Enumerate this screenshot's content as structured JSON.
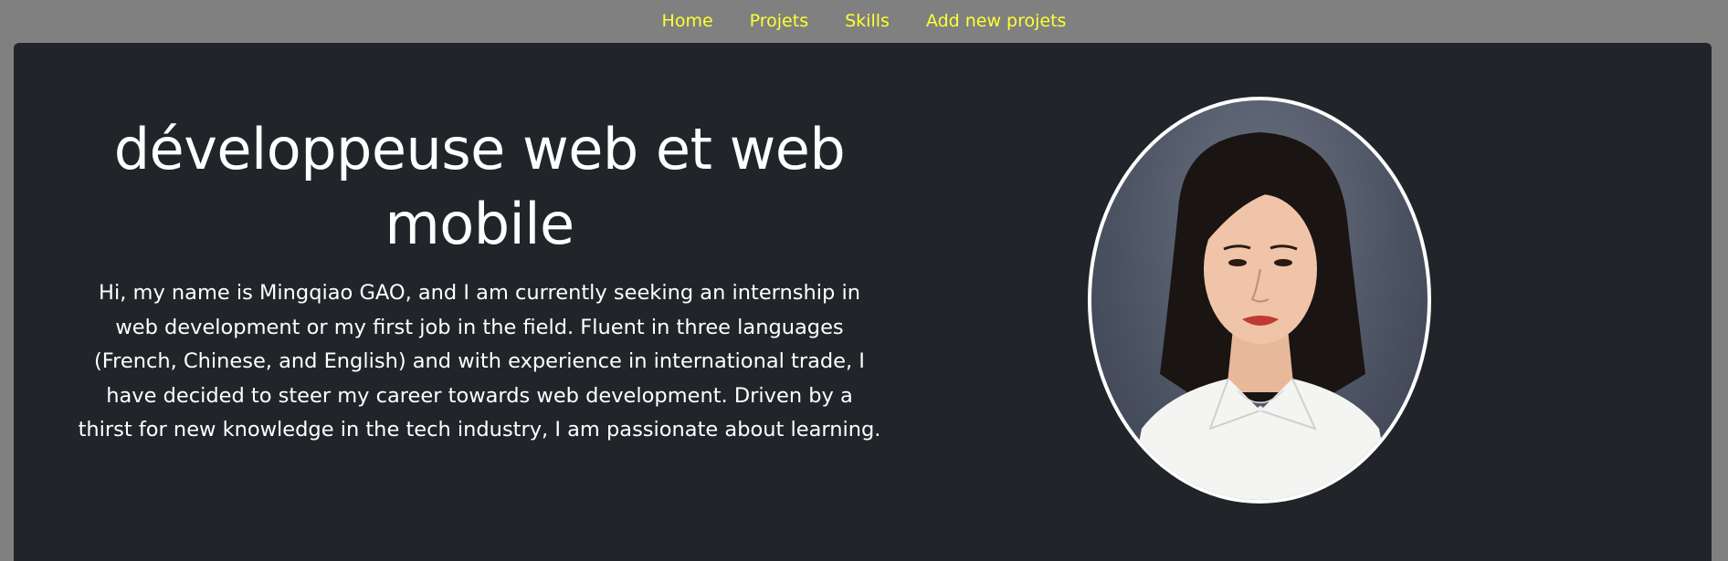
{
  "nav": {
    "items": [
      {
        "label": "Home"
      },
      {
        "label": "Projets"
      },
      {
        "label": "Skills"
      },
      {
        "label": "Add new projets"
      }
    ],
    "link_color": "#ffff33"
  },
  "hero": {
    "title": "développeuse web et web mobile",
    "intro": "Hi, my name is Mingqiao GAO, and I am currently seeking an internship in web development or my first job in the field. Fluent in three languages (French, Chinese, and English) and with experience in international trade, I have decided to steer my career towards web development. Driven by a thirst for new knowledge in the tech industry, I am passionate about learning.",
    "background_color": "#212529",
    "text_color": "#ffffff",
    "portrait_icon": "profile-photo"
  },
  "page": {
    "background_color": "#808080"
  }
}
